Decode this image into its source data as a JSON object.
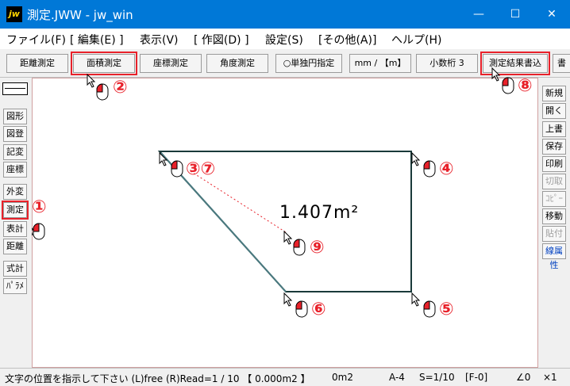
{
  "window": {
    "title": "測定.JWW - jw_win",
    "icon_text": "jw",
    "minimize": "—",
    "maximize": "☐",
    "close": "✕"
  },
  "menu": [
    "ファイル(F)",
    "[ 編集(E) ]",
    "表示(V)",
    "[ 作図(D) ]",
    "設定(S)",
    "[その他(A)]",
    "ヘルプ(H)"
  ],
  "toolbar": {
    "distance": "距離測定",
    "area": "面積測定",
    "coord": "座標測定",
    "angle": "角度測定",
    "single_circle": "○単独円指定",
    "unit": "mm / 【m】",
    "decimals": "小数桁 3",
    "write_result": "測定結果書込",
    "extra": "書"
  },
  "left_tools": [
    "図形",
    "図登",
    "記変",
    "座標",
    "外変",
    "測定",
    "表計",
    "距離",
    "式計",
    "ﾊﾟﾗﾒ"
  ],
  "right_tools": [
    "新規",
    "開く",
    "上書",
    "保存",
    "印刷",
    "切取",
    "ｺﾋﾟｰ",
    "移動",
    "貼付",
    "線属性"
  ],
  "canvas": {
    "area_result": "1.407m²"
  },
  "markers": {
    "m1": "①",
    "m2": "②",
    "m3": "③⑦",
    "m4": "④",
    "m5": "⑤",
    "m6": "⑥",
    "m8": "⑧",
    "m9": "⑨"
  },
  "status": {
    "message": "文字の位置を指示して下さい (L)free (R)Read=1 / 10 【 0.000m2 】",
    "value": "0m2",
    "paper": "A-4",
    "scale": "S=1/10",
    "layer": "[F-0]",
    "angle": "∠0",
    "zoom": "×1"
  },
  "colors": {
    "title_bar": "#0078d7",
    "highlight": "#e8212a",
    "shape_line": "#1a3a3a"
  }
}
